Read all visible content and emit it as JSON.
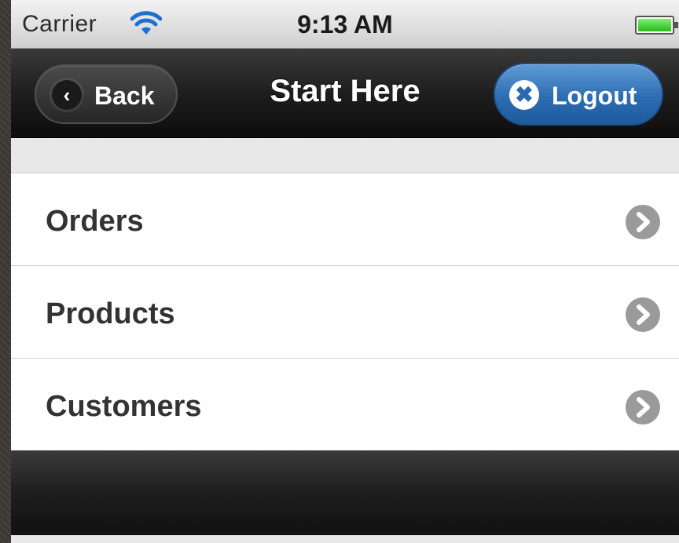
{
  "status_bar": {
    "carrier": "Carrier",
    "time": "9:13 AM",
    "icons": [
      "wifi-icon",
      "battery-icon"
    ],
    "battery_color": "#28b81a"
  },
  "nav_bar": {
    "title": "Start Here",
    "back_label": "Back",
    "back_icon": "chevron-left-icon",
    "logout_label": "Logout",
    "logout_icon": "close-icon",
    "logout_color": "#2d6db2"
  },
  "list": {
    "items": [
      {
        "label": "Orders"
      },
      {
        "label": "Products"
      },
      {
        "label": "Customers"
      }
    ],
    "item_icon": "chevron-right-icon"
  }
}
